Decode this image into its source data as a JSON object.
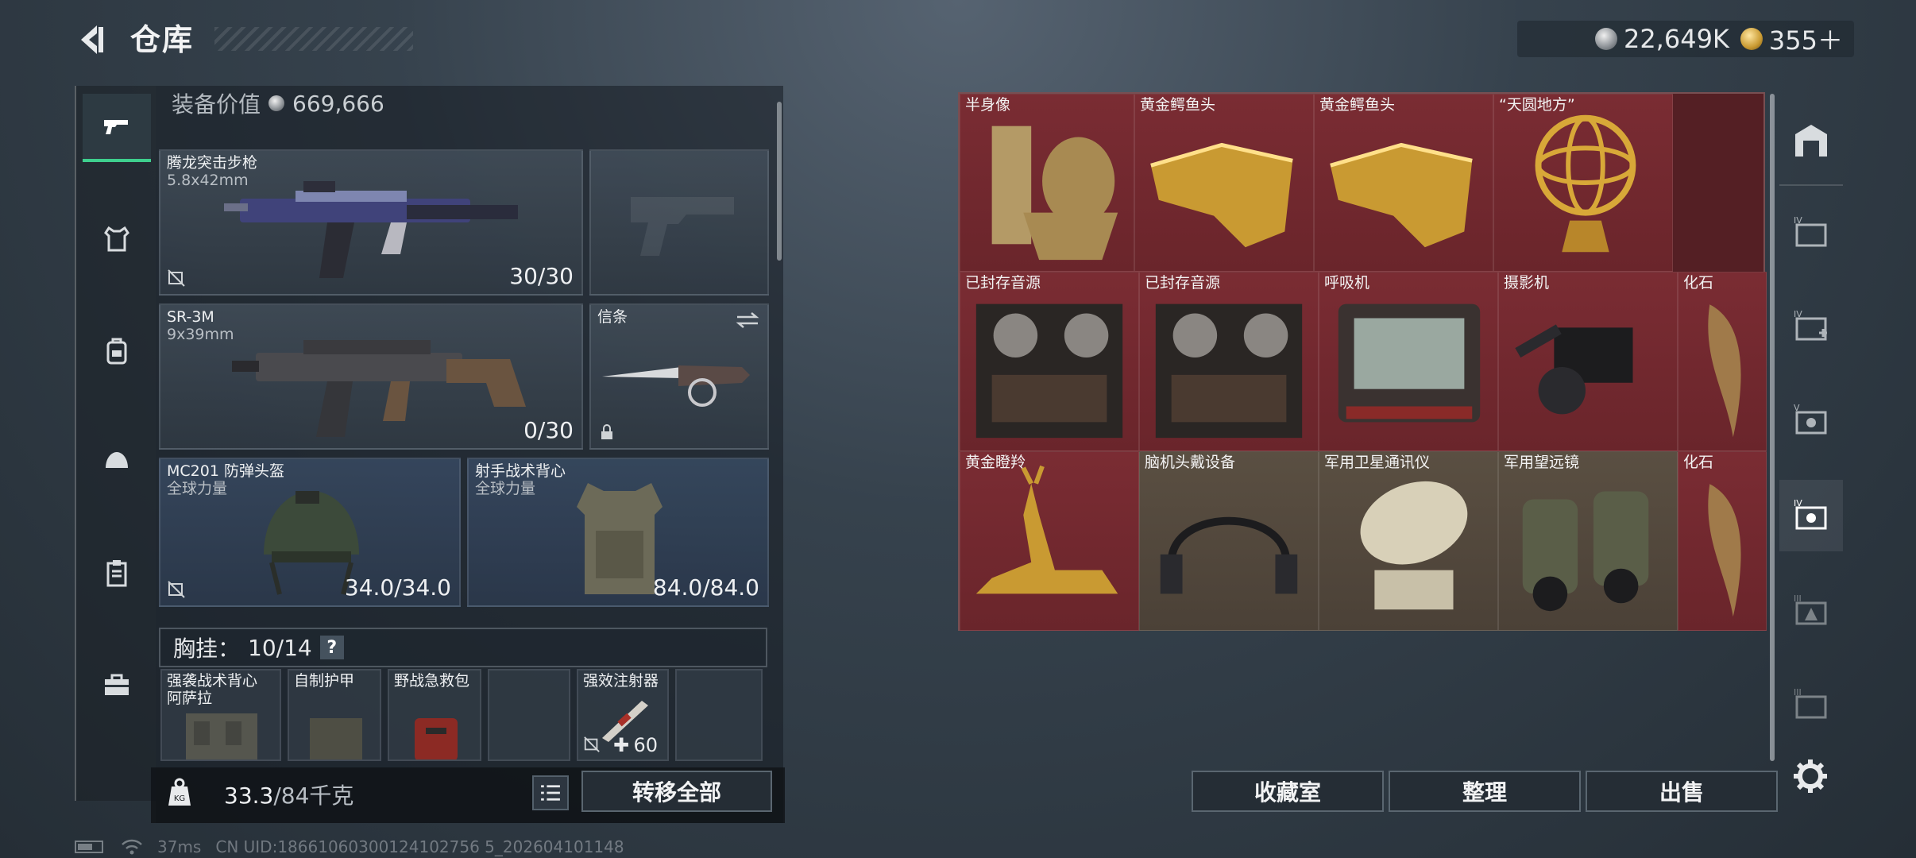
{
  "header": {
    "title": "仓库",
    "currencies": [
      {
        "icon": "silver-coin-icon",
        "value": "22,649K"
      },
      {
        "icon": "gold-coin-icon",
        "value": "355＋"
      }
    ]
  },
  "left_nav": {
    "items": [
      {
        "name": "weapons",
        "icon": "pistol-icon",
        "active": true
      },
      {
        "name": "armor",
        "icon": "vest-icon",
        "active": false
      },
      {
        "name": "backpack",
        "icon": "backpack-icon",
        "active": false
      },
      {
        "name": "rig",
        "icon": "helmet-icon",
        "active": false
      },
      {
        "name": "containers",
        "icon": "clipboard-icon",
        "active": false
      },
      {
        "name": "toolbox",
        "icon": "toolbox-icon",
        "active": false
      }
    ]
  },
  "equipment": {
    "value_label": "装备价值",
    "value": "669,666",
    "primary_weapon": {
      "name": "腾龙突击步枪",
      "caliber": "5.8x42mm",
      "ammo": "30/30"
    },
    "secondary_weapon": {
      "name": "SR-3M",
      "caliber": "9x39mm",
      "ammo": "0/30"
    },
    "melee": {
      "name": "信条"
    },
    "helmet": {
      "name": "MC201 防弹头盔",
      "faction": "全球力量",
      "durability": "34.0/34.0"
    },
    "armor": {
      "name": "射手战术背心",
      "faction": "全球力量",
      "durability": "84.0/84.0"
    },
    "chest_rig": {
      "label": "胸挂：",
      "capacity": "10/14",
      "help": "?"
    },
    "rig_items": [
      {
        "name": "强袭战术背心\n阿萨拉"
      },
      {
        "name": "自制护甲"
      },
      {
        "name": "野战急救包"
      },
      {
        "name": ""
      },
      {
        "name": "强效注射器",
        "count": "60"
      },
      {
        "name": ""
      }
    ]
  },
  "footer_left": {
    "weight": "33.3",
    "weight_max": "/84千克",
    "transfer_all": "转移全部"
  },
  "storage": {
    "items": [
      {
        "name": "半身像"
      },
      {
        "name": "黄金鳄鱼头"
      },
      {
        "name": "黄金鳄鱼头"
      },
      {
        "name": "“天圆地方”"
      },
      {
        "name": "已封存音源"
      },
      {
        "name": "已封存音源"
      },
      {
        "name": "呼吸机"
      },
      {
        "name": "摄影机"
      },
      {
        "name": "化石"
      },
      {
        "name": "黄金瞪羚"
      },
      {
        "name": "脑机头戴设备"
      },
      {
        "name": "军用卫星通讯仪"
      },
      {
        "name": "军用望远镜"
      },
      {
        "name": "化石"
      }
    ]
  },
  "actions": {
    "collection": "收藏室",
    "organize": "整理",
    "sell": "出售"
  },
  "right_nav": {
    "tiers": [
      "",
      "IV",
      "IV",
      "V",
      "IV",
      "III",
      "III"
    ]
  },
  "status": {
    "latency": "37ms",
    "uid": "CN UID:18661060300124102756 5_202604101148"
  },
  "colors": {
    "accent": "#3ecf8e",
    "item_red": "#6e272d",
    "gold": "#c99a32"
  }
}
